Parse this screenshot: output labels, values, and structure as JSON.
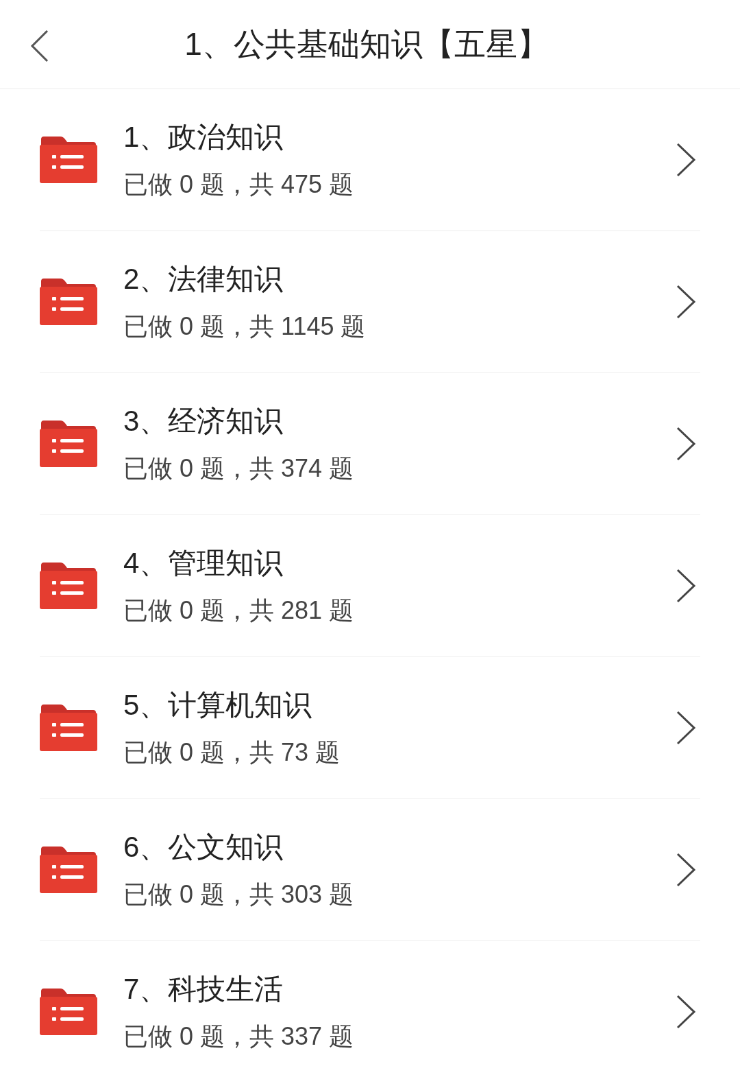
{
  "header": {
    "title": "1、公共基础知识【五星】"
  },
  "items": [
    {
      "title": "1、政治知识",
      "progress": "已做 0 题，共 475 题"
    },
    {
      "title": "2、法律知识",
      "progress": "已做 0 题，共 1145 题"
    },
    {
      "title": "3、经济知识",
      "progress": "已做 0 题，共 374 题"
    },
    {
      "title": "4、管理知识",
      "progress": "已做 0 题，共 281 题"
    },
    {
      "title": "5、计算机知识",
      "progress": "已做 0 题，共 73 题"
    },
    {
      "title": "6、公文知识",
      "progress": "已做 0 题，共 303 题"
    },
    {
      "title": "7、科技生活",
      "progress": "已做 0 题，共 337 题"
    }
  ]
}
